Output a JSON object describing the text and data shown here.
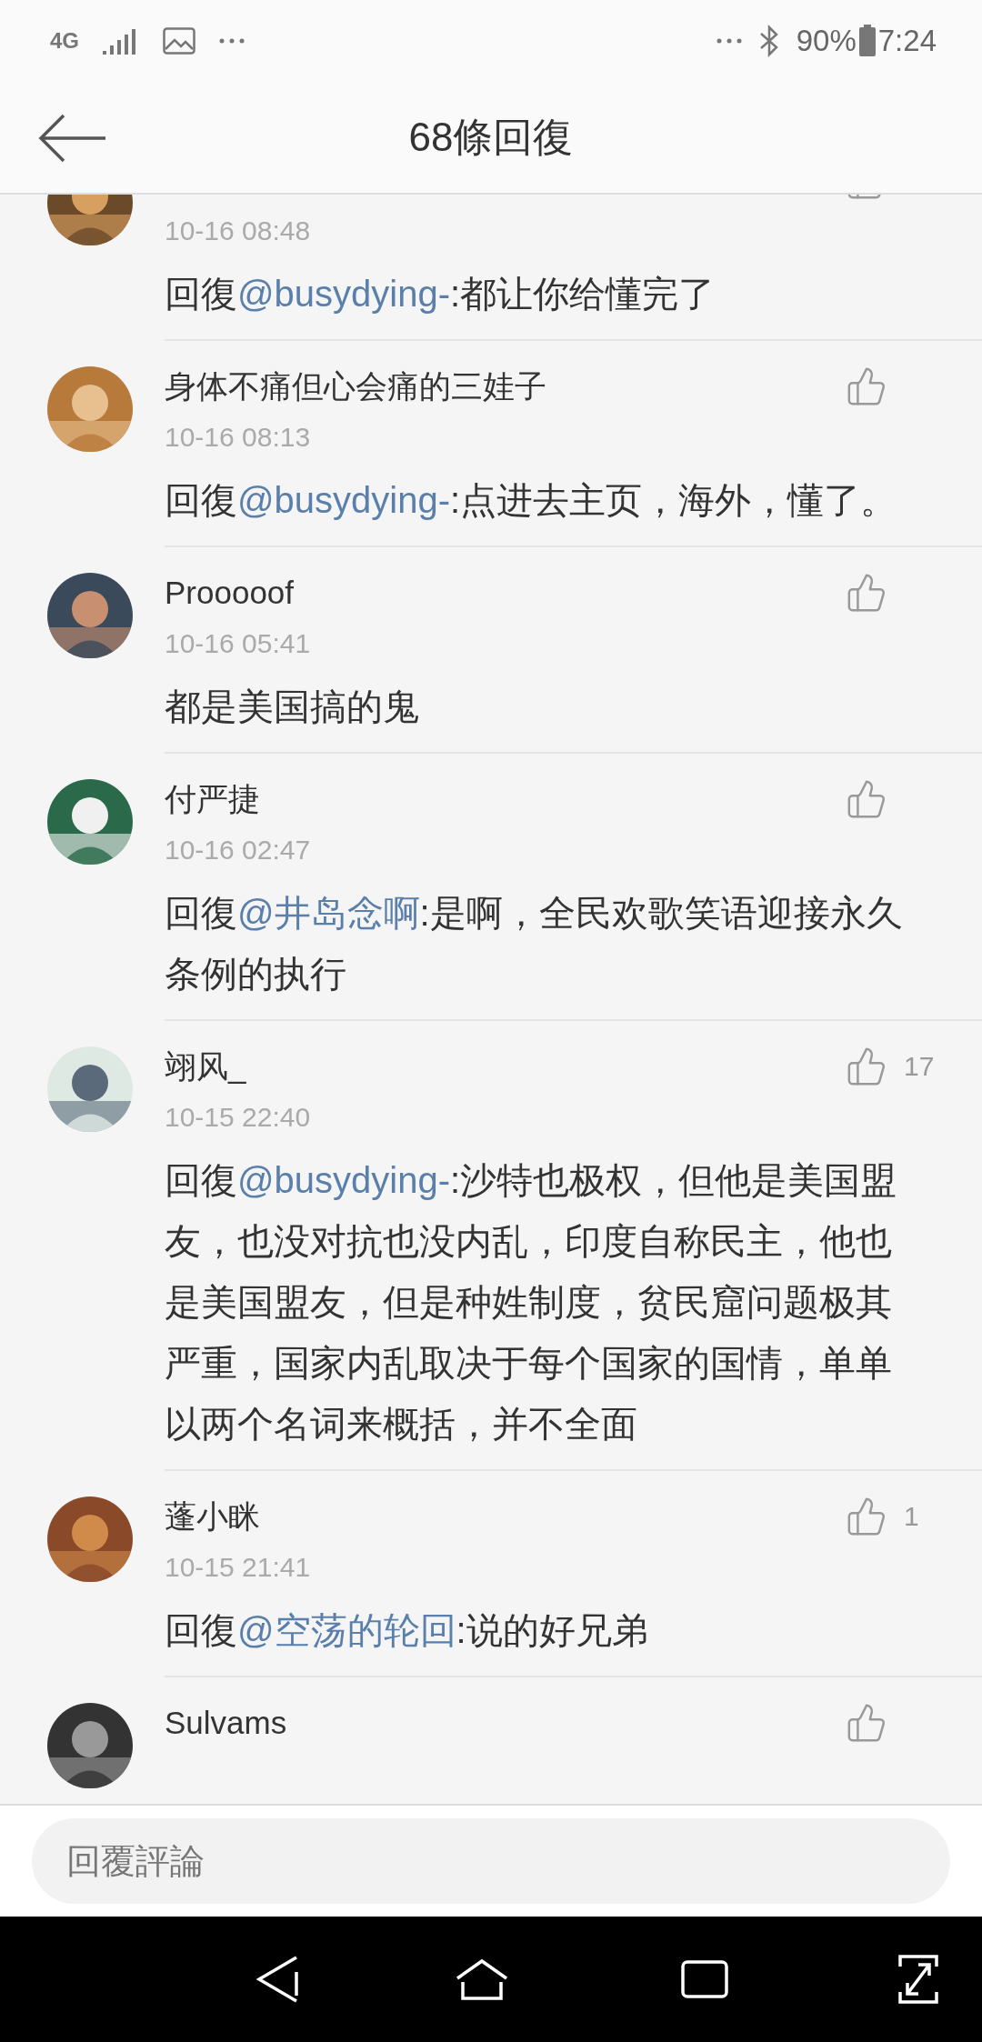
{
  "status_bar": {
    "network": "4G",
    "battery": "90%",
    "time": "7:24"
  },
  "header": {
    "title": "68條回復"
  },
  "comments": [
    {
      "time": "10-16 08:48",
      "reply_prefix": "回復",
      "mention": "@busydying-",
      "text": ":都让你给懂完了"
    },
    {
      "name": "身体不痛但心会痛的三娃子",
      "time": "10-16 08:13",
      "reply_prefix": "回復",
      "mention": "@busydying-",
      "text": ":点进去主页，海外，懂了。"
    },
    {
      "name": "Prooooof",
      "time": "10-16 05:41",
      "text": "都是美国搞的鬼"
    },
    {
      "name": "付严捷",
      "time": "10-16 02:47",
      "reply_prefix": "回復",
      "mention": "@井岛念啊",
      "text": ":是啊，全民欢歌笑语迎接永久条例的执行"
    },
    {
      "name": "翊风_",
      "time": "10-15 22:40",
      "reply_prefix": "回復",
      "mention": "@busydying-",
      "text": ":沙特也极权，但他是美国盟友，也没对抗也没内乱，印度自称民主，他也是美国盟友，但是种姓制度，贫民窟问题极其严重，国家内乱取决于每个国家的国情，单单以两个名词来概括，并不全面",
      "likes": "17"
    },
    {
      "name": "蓬小眯",
      "time": "10-15 21:41",
      "reply_prefix": "回復",
      "mention": "@空荡的轮回",
      "text": ":说的好兄弟",
      "likes": "1"
    },
    {
      "name": "Sulvams"
    }
  ],
  "reply_bar": {
    "placeholder": "回覆評論"
  }
}
